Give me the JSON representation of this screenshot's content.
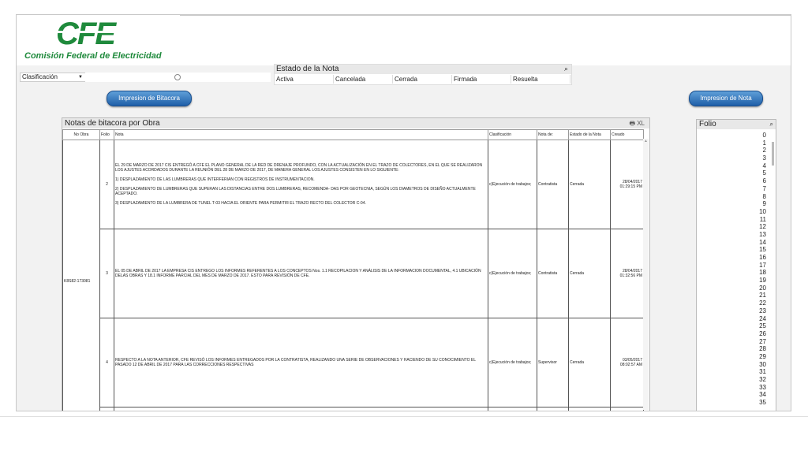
{
  "logo": {
    "text": "CFE",
    "subtitle": "Comisión Federal de Electricidad"
  },
  "clasificacion": {
    "label": "Clasificación"
  },
  "estado": {
    "title": "Estado de la Nota",
    "options": [
      "Activa",
      "Cancelada",
      "Cerrada",
      "Firmada",
      "Resuelta"
    ]
  },
  "buttons": {
    "bitacora": "Impresion de Bitacora",
    "nota": "Impresion de Nota"
  },
  "notas": {
    "title": "Notas de bitacora por Obra",
    "tools": "🖶 XL",
    "headers": [
      "No Obra",
      "Folio",
      "Nota",
      "Clasificación",
      "Nota de:",
      "Estado de la Nota",
      "Creado"
    ],
    "obra": "K8S82-173081",
    "rows": [
      {
        "folio": "2",
        "nota": "EL 29 DE MARZO DE 2017 CIS ENTREGÓ A CFE EL PLANO GENERAL DE LA RED DE DRENAJE PROFUNDO, CON LA ACTUALIZACIÓN EN EL TRAZO DE COLECTORES, EN EL QUE SE REALIZARON LOS AJUSTES ACORDADOS DURANTE LA REUNIÓN DEL 28 DE MARZO DE 2017, DE MANERA GENERAL LOS AJUSTES CONSISTEN EN LO SIGUIENTE:\n\n1) DESPLAZAMIENTO DE LAS LUMBRERAS QUE INTERFERIAN CON REGISTROS DE INSTRUMENTACION.\n\n2) DESPLAZAMIENTO DE LUMBRERAS QUE SUPERAN LAS DISTANCIAS ENTRE DOS LUMBRERAS, RECOMENDA- DAS POR GEOTECNIA, SEGÚN LOS DIAMETROS DE DISEÑO ACTUALMENTE ACEPTADO.\n\n3) DESPLAZAMIENTO DE LA LUMBRERA DE TUNEL T-03 HACIA EL ORIENTE PARA PERMITIR EL TRAZO RECTO DEL COLECTOR C-04.",
        "clasificacion": "c)Ejecución de trabajos;",
        "nota_de": "Contratista",
        "estado": "Cerrada",
        "creado": "28/04/2017 01:29:15 PM"
      },
      {
        "folio": "3",
        "nota": "EL 05 DE ABRIL DE 2017 LA EMPRESA CIS ENTREGO LOS INFORMES REFERENTES A LOS CONCEPTOS Nos. 1.1 RECOPILACION Y ANÁLISIS DE LA INFORMACION DOCUMENTAL, 4.1 UBICACIÓN DELAS OBRAS Y 18.1 INFORME PARCIAL DEL MES DE MARZO DE 2017. ESTO PARA REVISIÓN DE CFE.",
        "clasificacion": "c)Ejecución de trabajos;",
        "nota_de": "Contratista",
        "estado": "Cerrada",
        "creado": "28/04/2017 01:32:56 PM"
      },
      {
        "folio": "4",
        "nota": "RESPECTO A LA NOTA ANTERIOR, CFE REVISÓ LOS INFORMES ENTREGADOS POR LA CONTRATISTA, REALIZANDO UNA SERIE DE OBSERVACIONES Y HACIENDO DE SU CONOCIMIENTO EL PASADO 12 DE ABRIL DE 2017 PARA LAS CORRECCIONES RESPECTIVAS",
        "clasificacion": "c)Ejecución de trabajos;",
        "nota_de": "Supervisor",
        "estado": "Cerrada",
        "creado": "03/05/2017 08:02:57 AM"
      }
    ]
  },
  "folio": {
    "title": "Folio",
    "items": [
      "0",
      "1",
      "2",
      "3",
      "4",
      "5",
      "6",
      "7",
      "8",
      "9",
      "10",
      "11",
      "12",
      "13",
      "14",
      "15",
      "16",
      "17",
      "18",
      "19",
      "20",
      "21",
      "22",
      "23",
      "24",
      "25",
      "26",
      "27",
      "28",
      "29",
      "30",
      "31",
      "32",
      "33",
      "34",
      "35"
    ]
  },
  "colors": {
    "brand_green": "#1f8a3c",
    "button_blue": "#1f5fa8"
  },
  "icons": {
    "search": "search-icon",
    "print": "print-icon",
    "dropdown": "chevron-down-icon"
  }
}
